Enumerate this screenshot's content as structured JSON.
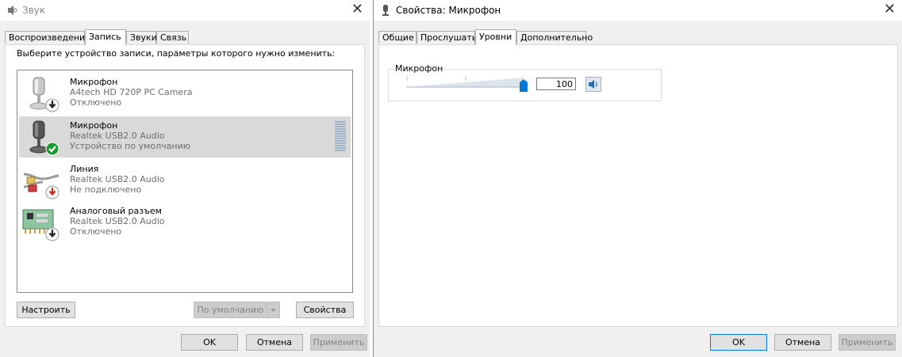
{
  "sound_dialog": {
    "title": "Звук",
    "tabs": [
      "Воспроизведение",
      "Запись",
      "Звуки",
      "Связь"
    ],
    "active_tab": 1,
    "instruction": "Выберите устройство записи, параметры которого нужно изменить:",
    "devices": [
      {
        "name": "Микрофон",
        "driver": "A4tech HD 720P PC Camera",
        "status": "Отключено",
        "icon": "microphone-icon",
        "badge": "down-arrow-badge-icon",
        "selected": false
      },
      {
        "name": "Микрофон",
        "driver": "Realtek USB2.0 Audio",
        "status": "Устройство по умолчанию",
        "icon": "microphone-icon",
        "badge": "green-check-badge-icon",
        "selected": true
      },
      {
        "name": "Линия",
        "driver": "Realtek USB2.0 Audio",
        "status": "Не подключено",
        "icon": "line-in-cable-icon",
        "badge": "red-down-arrow-badge-icon",
        "selected": false
      },
      {
        "name": "Аналоговый разъем",
        "driver": "Realtek USB2.0 Audio",
        "status": "Отключено",
        "icon": "sound-card-icon",
        "badge": "down-arrow-badge-icon",
        "selected": false
      }
    ],
    "configure_label": "Настроить",
    "default_label": "По умолчанию",
    "properties_label": "Свойства",
    "ok_label": "OK",
    "cancel_label": "Отмена",
    "apply_label": "Применить"
  },
  "properties_dialog": {
    "title": "Свойства: Микрофон",
    "tabs": [
      "Общие",
      "Прослушать",
      "Уровни",
      "Дополнительно"
    ],
    "active_tab": 2,
    "group_label": "Микрофон",
    "level_value": "100",
    "level_fraction": 1.0,
    "ok_label": "OK",
    "cancel_label": "Отмена",
    "apply_label": "Применить"
  },
  "colors": {
    "accent": "#0078d7",
    "check_green": "#1c9a2e",
    "arrow_red": "#d9231c",
    "selection": "#d9d9d9"
  }
}
